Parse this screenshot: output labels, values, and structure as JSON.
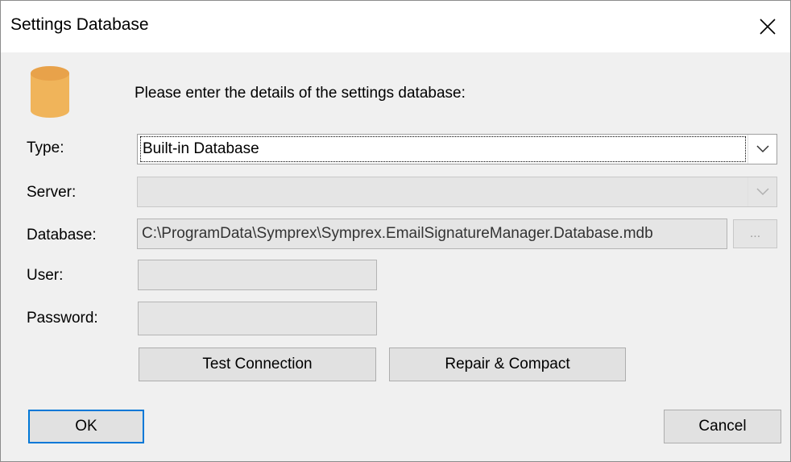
{
  "window": {
    "title": "Settings Database",
    "close_glyph": "✕"
  },
  "intro_text": "Please enter the details of the settings database:",
  "icons": {
    "database": "database-icon",
    "close": "close-icon",
    "dropdown": "chevron-down-icon"
  },
  "colors": {
    "icon_fill": "#f0b45a",
    "icon_top": "#e8a24a",
    "default_button_border": "#0078d7"
  },
  "form": {
    "type_label": "Type:",
    "type_value": "Built-in Database",
    "server_label": "Server:",
    "server_value": "",
    "database_label": "Database:",
    "database_value": "C:\\ProgramData\\Symprex\\Symprex.EmailSignatureManager.Database.mdb",
    "browse_label": "...",
    "user_label": "User:",
    "user_value": "",
    "password_label": "Password:",
    "password_value": ""
  },
  "buttons": {
    "test_connection": "Test Connection",
    "repair_compact": "Repair & Compact",
    "ok": "OK",
    "cancel": "Cancel"
  }
}
